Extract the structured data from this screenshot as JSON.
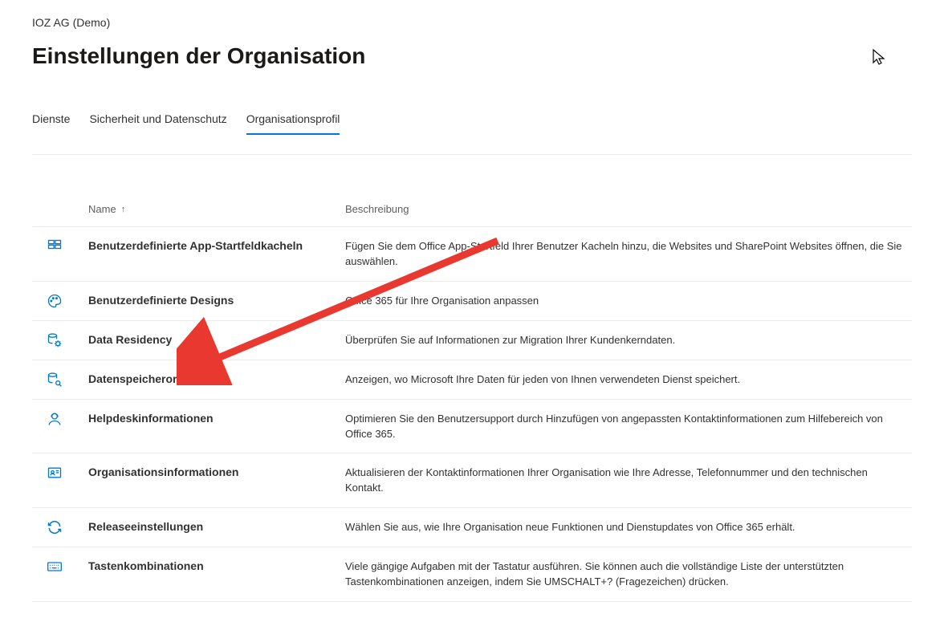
{
  "breadcrumb": "IOZ AG (Demo)",
  "title": "Einstellungen der Organisation",
  "tabs": [
    {
      "label": "Dienste",
      "active": false
    },
    {
      "label": "Sicherheit und Datenschutz",
      "active": false
    },
    {
      "label": "Organisationsprofil",
      "active": true
    }
  ],
  "columns": {
    "name": "Name",
    "sort_indicator": "↑",
    "description": "Beschreibung"
  },
  "rows": [
    {
      "icon": "tiles",
      "name": "Benutzerdefinierte App-Startfeldkacheln",
      "description": "Fügen Sie dem Office App-Startfeld Ihrer Benutzer Kacheln hinzu, die Websites und SharePoint Websites öffnen, die Sie auswählen."
    },
    {
      "icon": "palette",
      "name": "Benutzerdefinierte Designs",
      "description": "Office 365 für Ihre Organisation anpassen"
    },
    {
      "icon": "db-gear",
      "name": "Data Residency",
      "description": "Überprüfen Sie auf Informationen zur Migration Ihrer Kundenkerndaten."
    },
    {
      "icon": "db-search",
      "name": "Datenspeicherort",
      "description": "Anzeigen, wo Microsoft Ihre Daten für jeden von Ihnen verwendeten Dienst speichert."
    },
    {
      "icon": "person",
      "name": "Helpdeskinformationen",
      "description": "Optimieren Sie den Benutzersupport durch Hinzufügen von angepassten Kontaktinformationen zum Hilfebereich von Office 365."
    },
    {
      "icon": "card",
      "name": "Organisationsinformationen",
      "description": "Aktualisieren der Kontaktinformationen Ihrer Organisation wie Ihre Adresse, Telefonnummer und den technischen Kontakt."
    },
    {
      "icon": "refresh",
      "name": "Releaseeinstellungen",
      "description": "Wählen Sie aus, wie Ihre Organisation neue Funktionen und Dienstupdates von Office 365 erhält."
    },
    {
      "icon": "keyboard",
      "name": "Tastenkombinationen",
      "description": "Viele gängige Aufgaben mit der Tastatur ausführen. Sie können auch die vollständige Liste der unterstützten Tastenkombinationen anzeigen, indem Sie UMSCHALT+? (Fragezeichen) drücken."
    }
  ]
}
